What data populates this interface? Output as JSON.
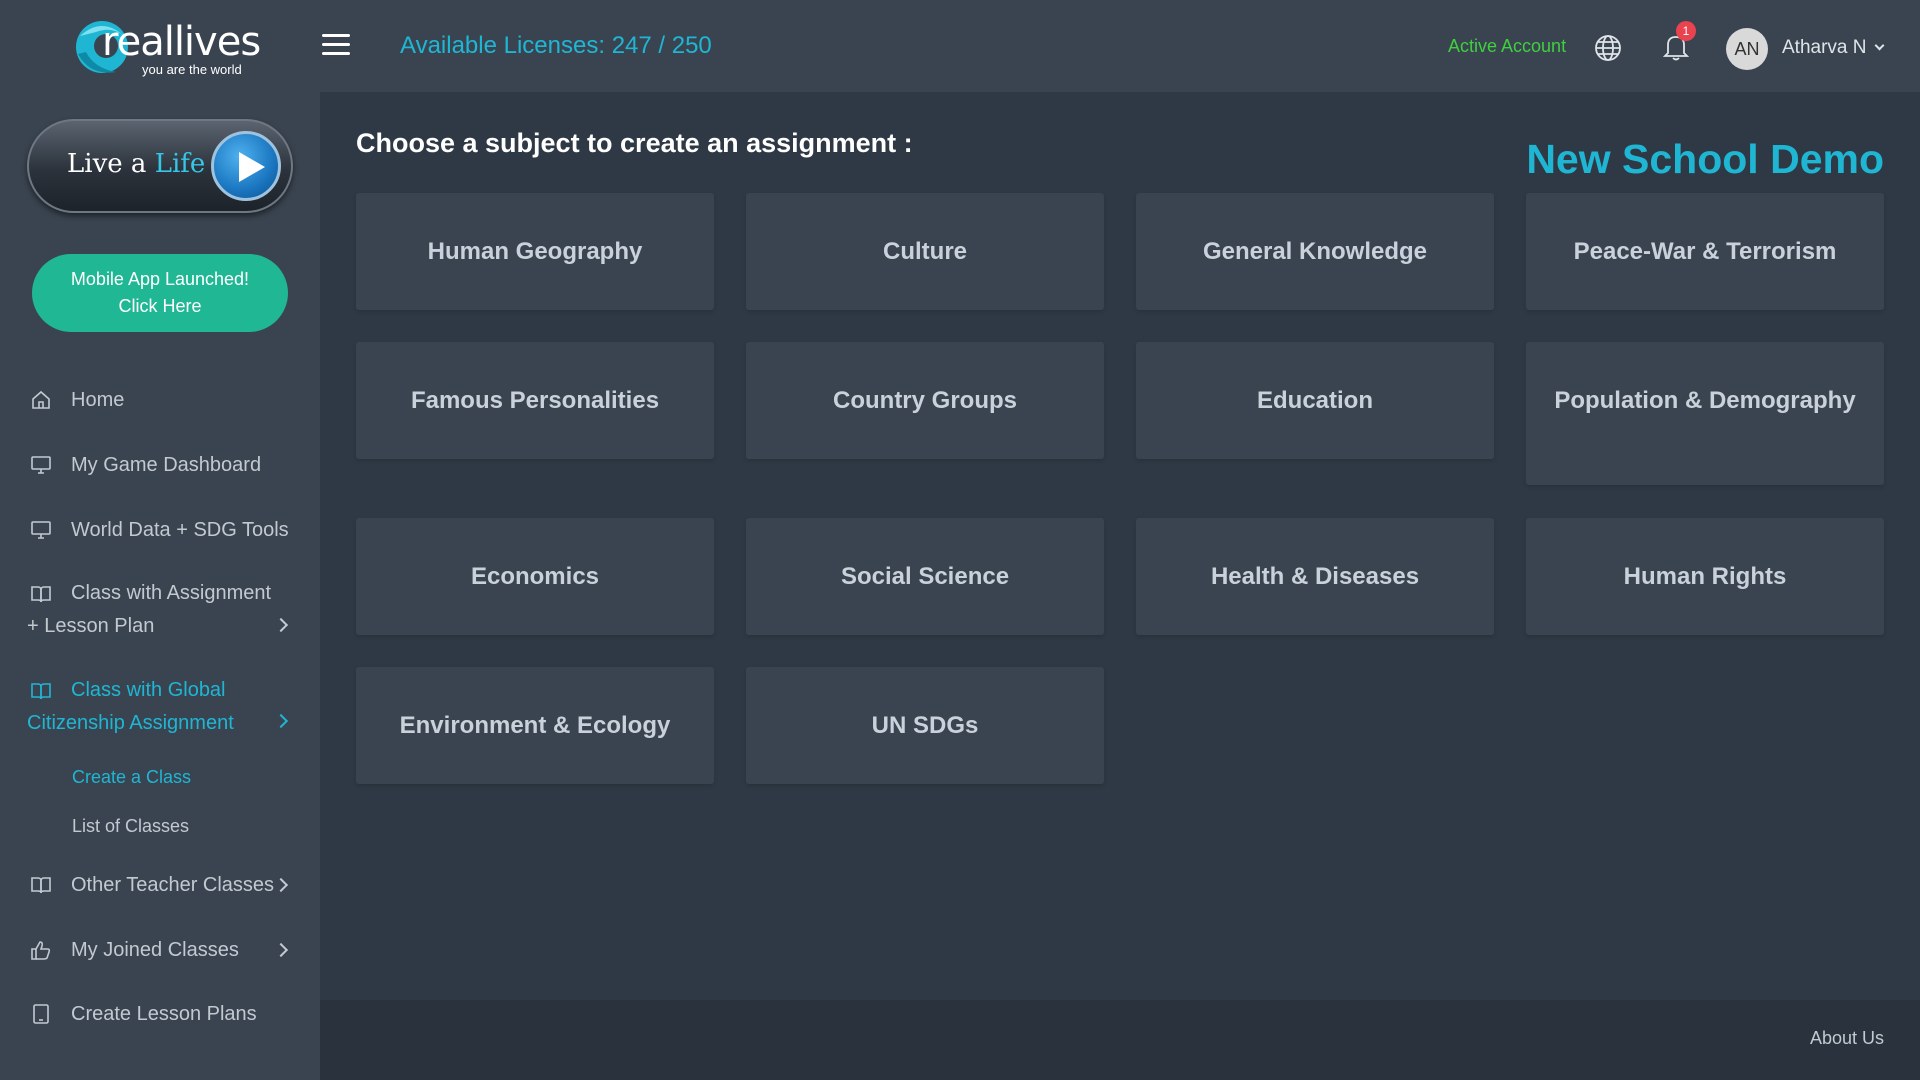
{
  "brand": {
    "name_part1": "r",
    "name_part2": "eallives",
    "tagline": "you are the world"
  },
  "sidebar": {
    "live_button": {
      "text1": "Live a ",
      "text2": "Life"
    },
    "mobile_button": {
      "line1": "Mobile App Launched!",
      "line2": "Click Here"
    },
    "items": [
      {
        "label": "Home",
        "icon": "home-icon"
      },
      {
        "label": "My Game Dashboard",
        "icon": "monitor-icon"
      },
      {
        "label": "World Data + SDG Tools",
        "icon": "monitor-icon"
      },
      {
        "label": "Class with Assignment + Lesson Plan",
        "icon": "book-open-icon"
      },
      {
        "label": "Class with Global Citizenship Assignment",
        "icon": "book-open-icon",
        "active": true
      },
      {
        "label": "Other Teacher Classes",
        "icon": "book-open-icon"
      },
      {
        "label": "My Joined Classes",
        "icon": "thumbs-up-icon"
      },
      {
        "label": "Create Lesson Plans",
        "icon": "tablet-icon"
      }
    ],
    "subitems": [
      {
        "label": "Create a Class",
        "active": true
      },
      {
        "label": "List of Classes"
      }
    ]
  },
  "topbar": {
    "licenses": "Available Licenses: 247 / 250",
    "account_status": "Active Account",
    "notification_count": "1",
    "avatar_initials": "AN",
    "username": "Atharva N"
  },
  "main": {
    "heading": "Choose a subject to create an assignment :",
    "school_name": "New School Demo",
    "subjects": [
      "Human Geography",
      "Culture",
      "General Knowledge",
      "Peace-War & Terrorism",
      "Famous Personalities",
      "Country Groups",
      "Education",
      "Population & Demography",
      "Economics",
      "Social Science",
      "Health & Diseases",
      "Human Rights",
      "Environment & Ecology",
      "UN SDGs"
    ]
  },
  "footer": {
    "about": "About Us"
  },
  "colors": {
    "accent": "#1fb6d4",
    "status_green": "#3fcf3f",
    "button_teal": "#20b795",
    "badge_red": "#e8434e",
    "sidebar_bg": "#3a4450",
    "main_bg": "#2f3945"
  }
}
